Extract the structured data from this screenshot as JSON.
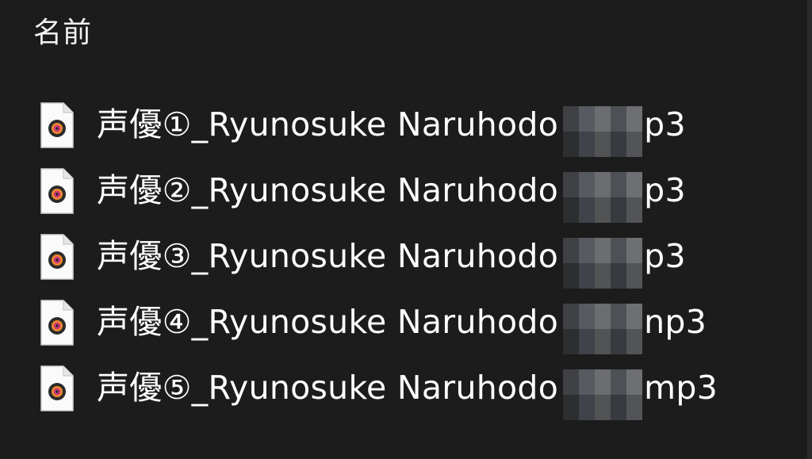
{
  "header": {
    "label": "名前"
  },
  "files": [
    {
      "name": "声優①_Ryunosuke Naruhodo",
      "ext": "p3"
    },
    {
      "name": "声優②_Ryunosuke Naruhodo",
      "ext": "p3"
    },
    {
      "name": "声優③_Ryunosuke Naruhodo",
      "ext": "p3"
    },
    {
      "name": "声優④_Ryunosuke Naruhodo",
      "ext": "np3"
    },
    {
      "name": "声優⑤_Ryunosuke Naruhodo",
      "ext": "mp3"
    }
  ],
  "icons": {
    "file": "audio-file-icon"
  }
}
